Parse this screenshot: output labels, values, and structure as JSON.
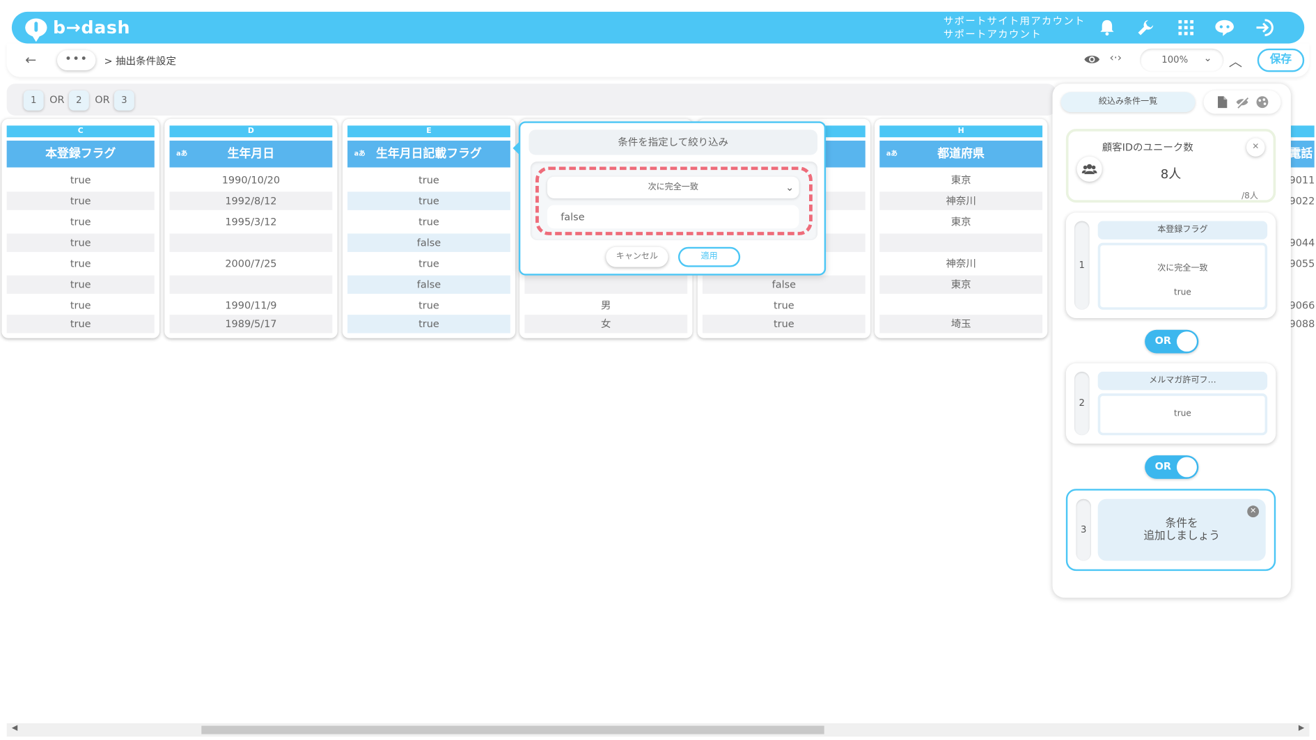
{
  "header": {
    "logo_text": "b→dash",
    "account_line1": "サポートサイト用アカウント",
    "account_line2": "サポートアカウント"
  },
  "toolbar": {
    "dots": "•••",
    "breadcrumb": "> 抽出条件設定",
    "code_label": "‹·›",
    "zoom": "100%",
    "save_label": "保存"
  },
  "formula": {
    "chips": [
      "1",
      "2",
      "3"
    ],
    "operator": "OR"
  },
  "columns": [
    {
      "letter": "C",
      "header": "本登録フラグ",
      "badge": "",
      "cells": [
        "true",
        "true",
        "true",
        "true",
        "true",
        "true",
        "true",
        "true"
      ]
    },
    {
      "letter": "D",
      "header": "生年月日",
      "badge": "aあ",
      "cells": [
        "1990/10/20",
        "1992/8/12",
        "1995/3/12",
        "",
        "2000/7/25",
        "",
        "1990/11/9",
        "1989/5/17"
      ]
    },
    {
      "letter": "E",
      "header": "生年月日記載フラグ",
      "badge": "aあ",
      "cells": [
        "true",
        "true",
        "true",
        "false",
        "true",
        "false",
        "true",
        "true"
      ]
    },
    {
      "letter": "",
      "header": "",
      "badge": "",
      "cells": [
        "",
        "",
        "",
        "",
        "",
        "",
        "男",
        "女"
      ]
    },
    {
      "letter": "",
      "header": "",
      "badge": "",
      "cells": [
        "",
        "",
        "",
        "",
        "",
        "false",
        "true",
        "true"
      ]
    },
    {
      "letter": "H",
      "header": "都道府県",
      "badge": "aあ",
      "cells": [
        "東京",
        "神奈川",
        "東京",
        "",
        "神奈川",
        "東京",
        "",
        "埼玉"
      ]
    }
  ],
  "partial_column": {
    "header": "電話",
    "cells": [
      "9011",
      "9022",
      "",
      "9044",
      "9055",
      "",
      "9066",
      "9088"
    ]
  },
  "popup": {
    "title": "条件を指定して絞り込み",
    "match_type": "次に完全一致",
    "value": "false",
    "cancel_label": "キャンセル",
    "apply_label": "適用"
  },
  "panel": {
    "title": "絞込み条件一覧",
    "stat_label": "顧客IDのユニーク数",
    "stat_value": "8人",
    "stat_sub": "/8人",
    "conditions": [
      {
        "num": "1",
        "name": "本登録フラグ",
        "match": "次に完全一致",
        "value": "true"
      },
      {
        "num": "2",
        "name": "メルマガ許可フ…",
        "match": "",
        "value": "true"
      }
    ],
    "toggle_label": "OR",
    "add_num": "3",
    "add_line1": "条件を",
    "add_line2": "追加しましょう"
  },
  "colors": {
    "brand": "#4cc6f5",
    "header_blue": "#58b5ee",
    "dashed_highlight": "#ee6c7a"
  }
}
